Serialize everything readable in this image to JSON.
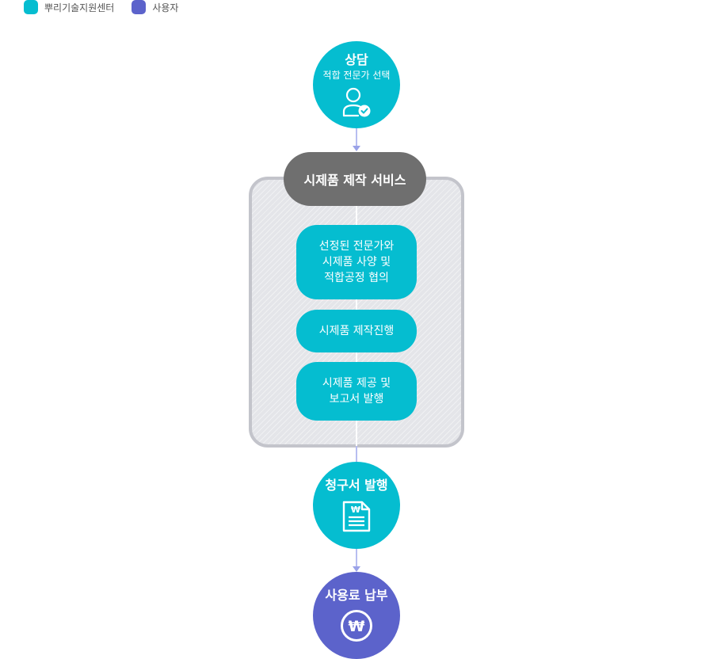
{
  "legend": [
    {
      "label": "뿌리기술지원센터",
      "color": "#05bdd0"
    },
    {
      "label": "사용자",
      "color": "#5c63cb"
    }
  ],
  "nodes": {
    "consult": {
      "title": "상담",
      "subtitle": "적합 전문가 선택",
      "icon": "user-check-icon",
      "role": "뿌리기술지원센터"
    },
    "group": {
      "title": "시제품 제작 서비스",
      "steps": [
        {
          "lines": [
            "선정된 전문가와",
            "시제품 사양 및",
            "적합공정 협의"
          ]
        },
        {
          "lines": [
            "시제품 제작진행"
          ]
        },
        {
          "lines": [
            "시제품 제공 및",
            "보고서 발행"
          ]
        }
      ]
    },
    "invoice": {
      "title": "청구서 발행",
      "icon": "invoice-document-icon",
      "icon_text": "₩",
      "role": "뿌리기술지원센터"
    },
    "payment": {
      "title": "사용료 납부",
      "icon": "won-coin-icon",
      "icon_text": "₩",
      "role": "사용자"
    }
  },
  "colors": {
    "center": "#05bdd0",
    "user": "#5c63cb",
    "group_header": "#6f6f6f",
    "group_border": "#c3c4cb",
    "connector": "#b7bdf0"
  }
}
